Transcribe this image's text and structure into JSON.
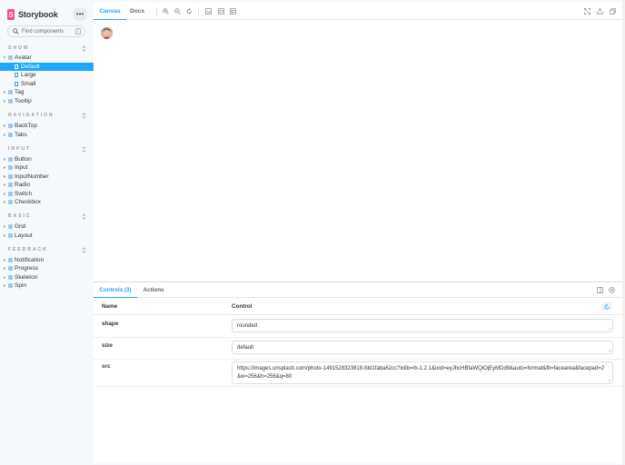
{
  "brand": {
    "name": "Storybook",
    "logo_letter": "S"
  },
  "menu_label": "•••",
  "search": {
    "placeholder": "Find components",
    "shortcut": "/"
  },
  "sidebar": {
    "sections": [
      {
        "title": "SHOW"
      },
      {
        "title": "NAVIGATION"
      },
      {
        "title": "INPUT"
      },
      {
        "title": "BASIC"
      },
      {
        "title": "FEEDBACK"
      }
    ],
    "items": [
      {
        "label": "Avatar"
      },
      {
        "label": "Default"
      },
      {
        "label": "Large"
      },
      {
        "label": "Small"
      },
      {
        "label": "Tag"
      },
      {
        "label": "Tooltip"
      },
      {
        "label": "BackTop"
      },
      {
        "label": "Tabs"
      },
      {
        "label": "Button"
      },
      {
        "label": "Input"
      },
      {
        "label": "InputNumber"
      },
      {
        "label": "Radio"
      },
      {
        "label": "Switch"
      },
      {
        "label": "Checkbox"
      },
      {
        "label": "Grid"
      },
      {
        "label": "Layout"
      },
      {
        "label": "Notification"
      },
      {
        "label": "Progress"
      },
      {
        "label": "Skeleton"
      },
      {
        "label": "Spin"
      }
    ],
    "selected": "Default"
  },
  "toolbar": {
    "tabs": [
      {
        "label": "Canvas"
      },
      {
        "label": "Docs"
      }
    ],
    "active_tab": "Canvas",
    "icons": [
      "zoom-in-icon",
      "zoom-out-icon",
      "reset-zoom-icon",
      "background-icon",
      "grid-icon",
      "outline-icon",
      "fullscreen-icon",
      "share-icon",
      "copy-link-icon"
    ]
  },
  "panel": {
    "tabs": [
      {
        "label": "Controls (3)"
      },
      {
        "label": "Actions"
      }
    ],
    "active_tab": "Controls (3)",
    "columns": {
      "name": "Name",
      "control": "Control"
    },
    "rows": [
      {
        "name": "shape",
        "value": "rounded"
      },
      {
        "name": "size",
        "value": "default"
      },
      {
        "name": "src",
        "value": "https://images.unsplash.com/photo-1491528323818-fdd1faba62cc?ixlib=rb-1.2.1&ixid=eyJhcHBfaWQiOjEyMDd9&auto=format&fit=facearea&facepad=2&w=256&h=256&q=80"
      }
    ]
  },
  "colors": {
    "accent": "#1ea7fd",
    "brand": "#ff4785",
    "sidebar_bg": "#f6f9fc"
  }
}
